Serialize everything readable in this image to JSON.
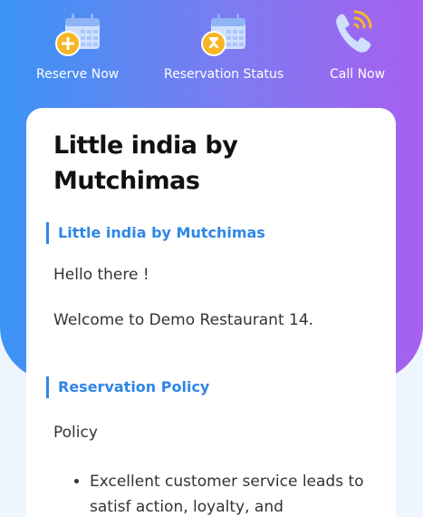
{
  "actions": {
    "reserve": {
      "label": "Reserve Now",
      "icon": "calendar-add-icon"
    },
    "status": {
      "label": "Reservation Status",
      "icon": "calendar-hourglass-icon"
    },
    "call": {
      "label": "Call Now",
      "icon": "phone-ringing-icon"
    }
  },
  "colors": {
    "gradient_start": "#3a94f5",
    "gradient_end": "#a85ff0",
    "accent": "#2f86e6",
    "badge": "#f6b625"
  },
  "card": {
    "title": "Little india by Mutchimas",
    "intro_heading": "Little india by Mutchimas",
    "greeting": "Hello there !",
    "welcome": "Welcome to Demo Restaurant 14.",
    "policy_heading": "Reservation Policy",
    "policy_label": "Policy",
    "policy_items": [
      "Excellent customer service leads to satisf action, loyalty, and"
    ]
  }
}
